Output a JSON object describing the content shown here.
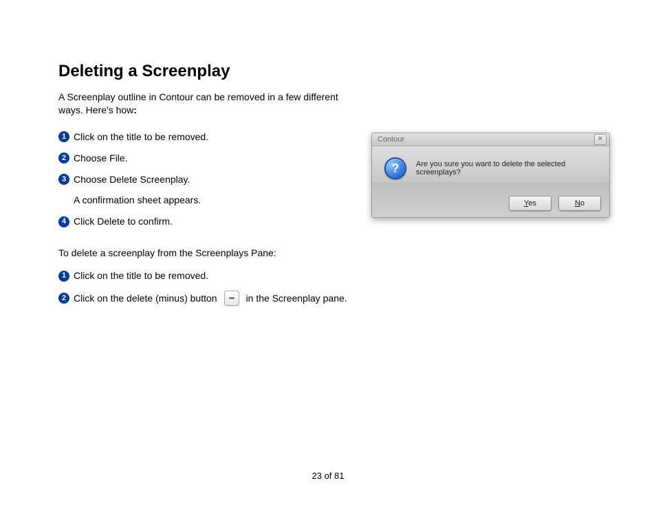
{
  "title": "Deleting a Screenplay",
  "intro_line1": "A Screenplay outline in Contour can be removed in a few different",
  "intro_line2": "ways. Here's how",
  "intro_colon": ":",
  "steps_a": {
    "s1": "Click on the title to be removed.",
    "s2": "Choose File.",
    "s3": "Choose Delete Screenplay.",
    "s3_sub": "A confirmation sheet appears.",
    "s4": "Click Delete to confirm."
  },
  "para2": "To delete a screenplay from the Screenplays Pane:",
  "steps_b": {
    "s1": "Click on the title to be removed.",
    "s2_pre": "Click on the delete (minus) button",
    "s2_post": "in the Screenplay pane."
  },
  "dialog": {
    "title": "Contour",
    "message": "Are you sure you want to delete the selected screenplays?",
    "yes": "Yes",
    "no": "No",
    "close_glyph": "✕",
    "q_glyph": "?"
  },
  "page_number": "23 of 81",
  "bullets": {
    "n1": "1",
    "n2": "2",
    "n3": "3",
    "n4": "4"
  }
}
